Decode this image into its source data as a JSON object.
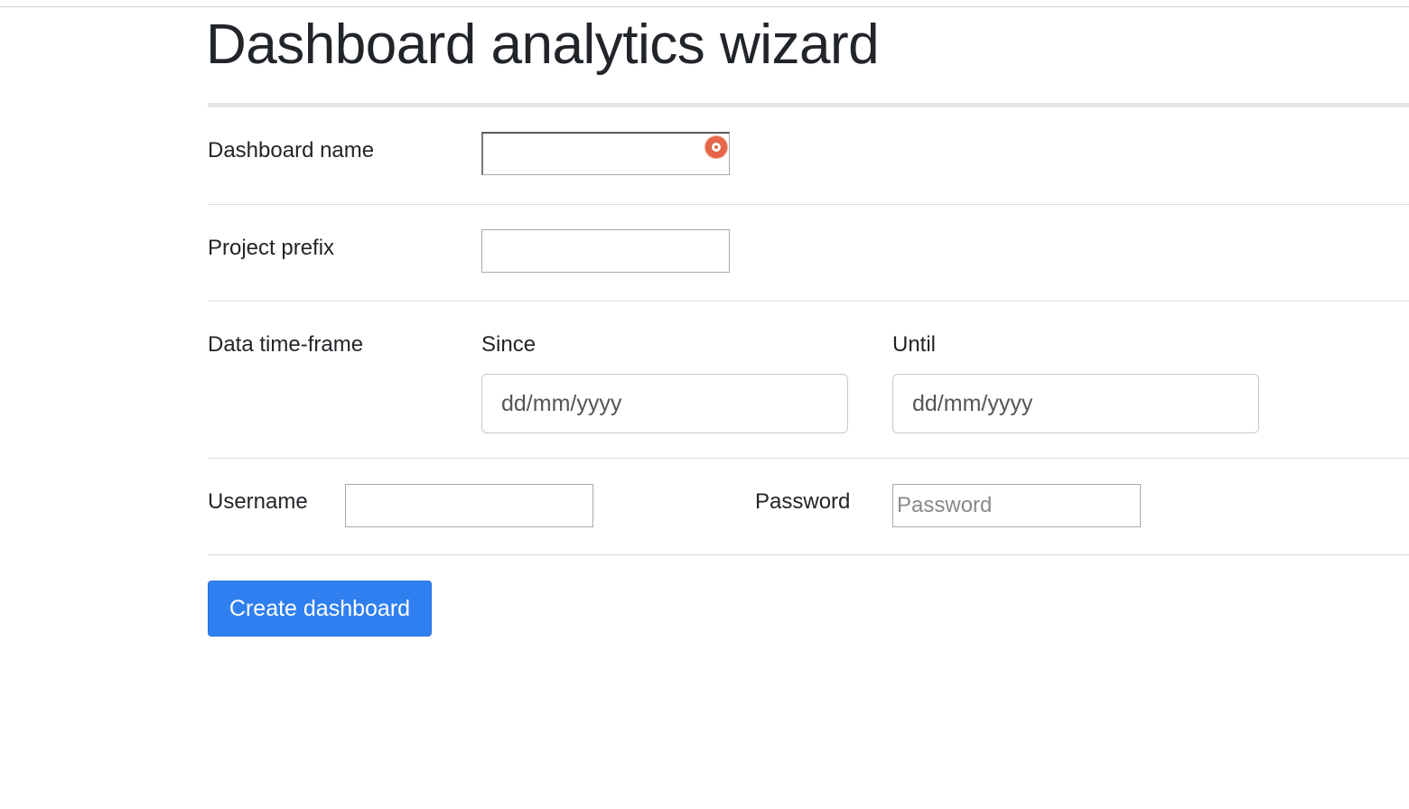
{
  "page": {
    "title": "Dashboard analytics wizard"
  },
  "form": {
    "dashboard_name": {
      "label": "Dashboard name",
      "value": ""
    },
    "project_prefix": {
      "label": "Project prefix",
      "value": ""
    },
    "time_frame": {
      "label": "Data time-frame",
      "since_label": "Since",
      "since_placeholder": "dd/mm/yyyy",
      "until_label": "Until",
      "until_placeholder": "dd/mm/yyyy"
    },
    "username": {
      "label": "Username",
      "value": ""
    },
    "password": {
      "label": "Password",
      "placeholder": "Password"
    },
    "submit_label": "Create dashboard"
  },
  "icons": {
    "autofill_badge": "password-manager-icon",
    "autofill_badge_color": "#e5664a"
  },
  "colors": {
    "primary_button": "#2f7ff0",
    "text": "#212529"
  }
}
